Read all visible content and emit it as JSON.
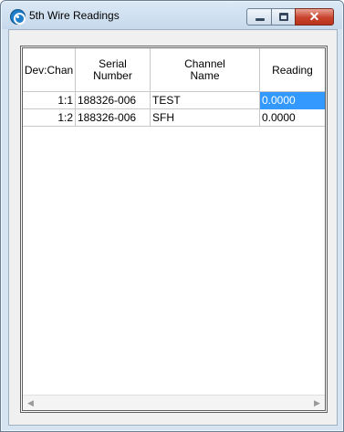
{
  "window": {
    "title": "5th Wire Readings",
    "minimize_icon": "minimize-icon",
    "maximize_icon": "maximize-icon",
    "close_icon": "close-icon",
    "close_glyph": "✕"
  },
  "grid": {
    "columns": [
      "Dev:Chan",
      "Serial\nNumber",
      "Channel\nName",
      "Reading"
    ],
    "rows": [
      {
        "dev_chan": "1:1",
        "serial": "188326-006",
        "name": "TEST",
        "reading": "0.0000",
        "selected": true
      },
      {
        "dev_chan": "1:2",
        "serial": "188326-006",
        "name": "SFH",
        "reading": "0.0000",
        "selected": false
      }
    ],
    "scroll_left_glyph": "◀",
    "scroll_right_glyph": "▶"
  },
  "colors": {
    "selection": "#3399ff",
    "title_bar": "#d6e4f2",
    "close_button": "#c8432c"
  }
}
